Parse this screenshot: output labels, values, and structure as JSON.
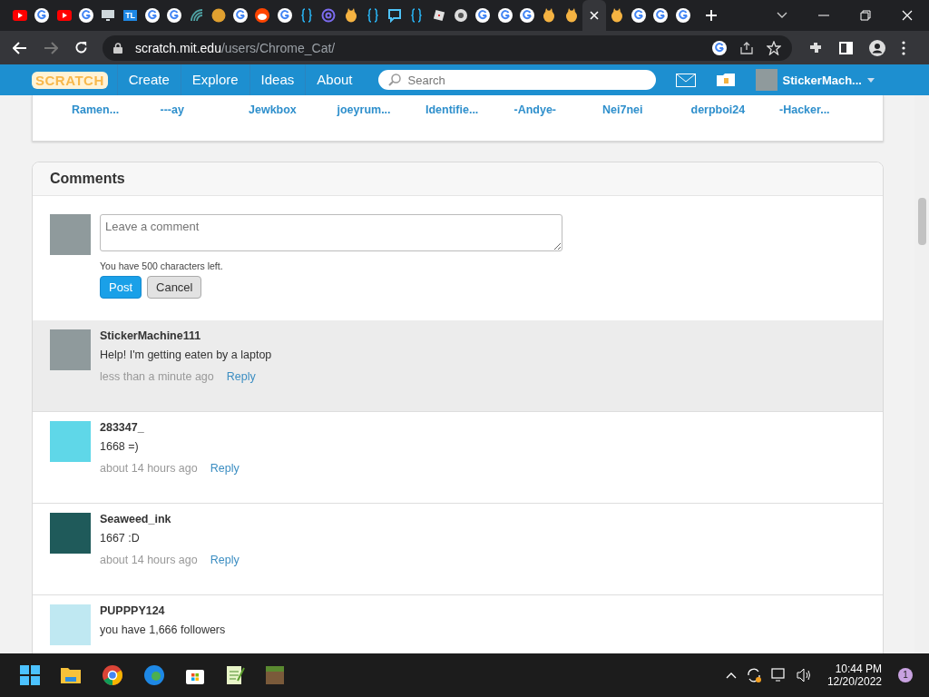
{
  "browser": {
    "tabs": [
      {
        "kind": "youtube",
        "selected": false
      },
      {
        "kind": "google",
        "selected": false
      },
      {
        "kind": "youtube",
        "selected": false
      },
      {
        "kind": "google",
        "selected": false
      },
      {
        "kind": "monitor",
        "selected": false
      },
      {
        "kind": "text",
        "label": "TL",
        "selected": false
      },
      {
        "kind": "google",
        "selected": false
      },
      {
        "kind": "google",
        "selected": false
      },
      {
        "kind": "wave",
        "selected": false
      },
      {
        "kind": "circle",
        "selected": false
      },
      {
        "kind": "google",
        "selected": false
      },
      {
        "kind": "reddit",
        "selected": false
      },
      {
        "kind": "google",
        "selected": false
      },
      {
        "kind": "braces",
        "selected": false
      },
      {
        "kind": "at",
        "selected": false
      },
      {
        "kind": "scratch",
        "selected": false
      },
      {
        "kind": "braces",
        "selected": false
      },
      {
        "kind": "chat",
        "selected": false
      },
      {
        "kind": "braces",
        "selected": false
      },
      {
        "kind": "roblox",
        "selected": false
      },
      {
        "kind": "chrome",
        "selected": false
      },
      {
        "kind": "google",
        "selected": false
      },
      {
        "kind": "google",
        "selected": false
      },
      {
        "kind": "google",
        "selected": false
      },
      {
        "kind": "scratch",
        "selected": false
      },
      {
        "kind": "scratch",
        "selected": false
      },
      {
        "selected": true
      },
      {
        "kind": "scratch",
        "selected": false
      },
      {
        "kind": "google",
        "selected": false
      },
      {
        "kind": "google",
        "selected": false
      },
      {
        "kind": "google",
        "selected": false
      }
    ],
    "url_host": "scratch.mit.edu",
    "url_path": "/users/Chrome_Cat/"
  },
  "nav": {
    "logo": "SCRATCH",
    "links": [
      "Create",
      "Explore",
      "Ideas",
      "About"
    ],
    "search_placeholder": "Search",
    "username": "StickerMach..."
  },
  "followers": [
    "Ramen...",
    "---ay",
    "Jewkbox",
    "joeyrum...",
    "Identifie...",
    "-Andye-",
    "Nei7nei",
    "derpboi24",
    "-Hacker..."
  ],
  "comments": {
    "title": "Comments",
    "placeholder": "Leave a comment",
    "chars_left": "You have 500 characters left.",
    "post": "Post",
    "cancel": "Cancel",
    "items": [
      {
        "user": "StickerMachine111",
        "text": "Help! I'm getting eaten by a laptop",
        "time": "less than a minute ago",
        "reply": "Reply",
        "highlighted": true
      },
      {
        "user": "283347_",
        "text": "1668 =)",
        "time": "about 14 hours ago",
        "reply": "Reply",
        "highlighted": false
      },
      {
        "user": "Seaweed_ink",
        "text": "1667 :D",
        "time": "about 14 hours ago",
        "reply": "Reply",
        "highlighted": false
      },
      {
        "user": "PUPPPY124",
        "text": "you have 1,666 followers",
        "highlighted": false
      }
    ]
  },
  "taskbar": {
    "time": "10:44 PM",
    "date": "12/20/2022",
    "notifications": "1"
  }
}
